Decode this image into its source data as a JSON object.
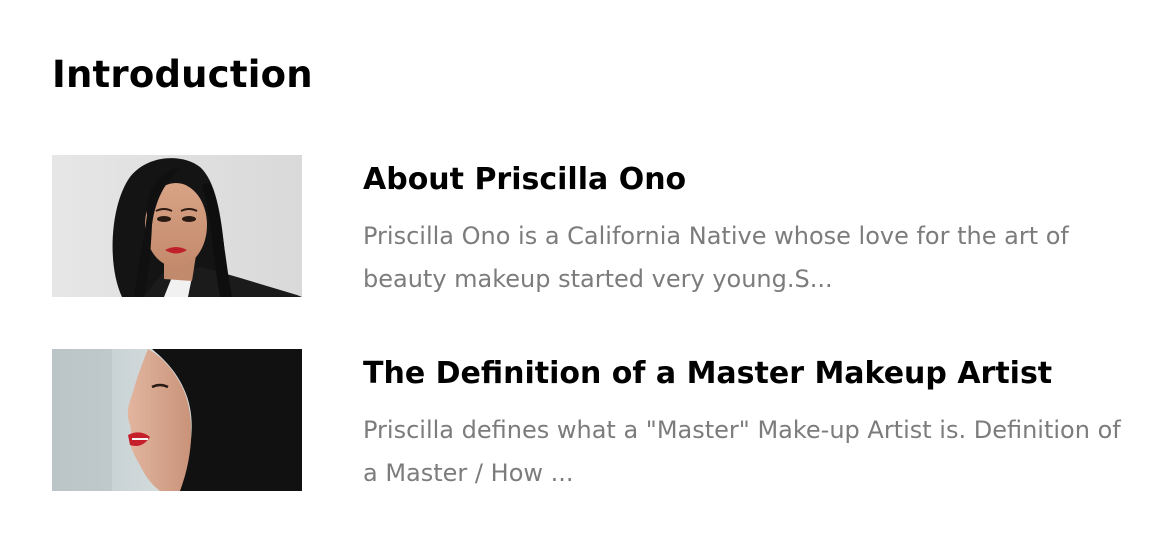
{
  "section": {
    "title": "Introduction"
  },
  "lessons": [
    {
      "title": "About Priscilla Ono",
      "description": "Priscilla Ono is a California Native whose love for the art of beauty makeup started very young.S...",
      "thumbnail": "portrait-front-photo"
    },
    {
      "title": "The Definition of a Master Makeup Artist",
      "description": "Priscilla defines what a \"Master\" Make-up Artist is. Definition of a Master / How ...",
      "thumbnail": "portrait-profile-photo"
    }
  ],
  "colors": {
    "title": "#000000",
    "description": "#7c7c7c",
    "background": "#ffffff"
  }
}
